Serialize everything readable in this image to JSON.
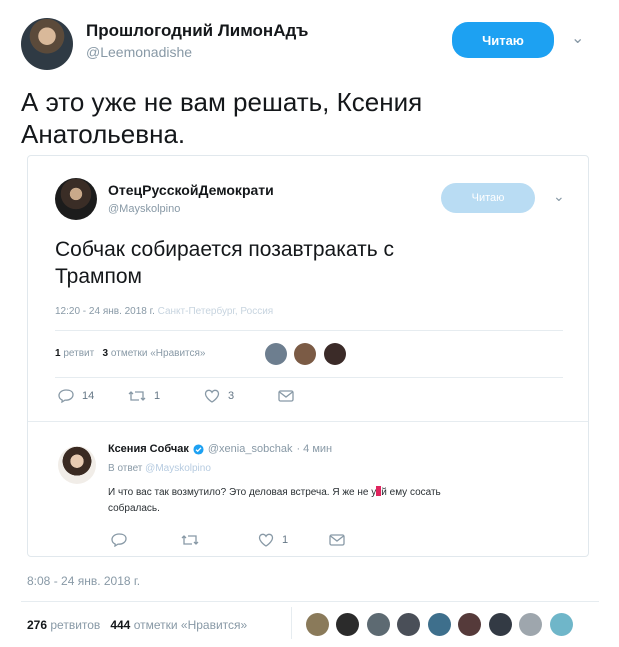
{
  "main_tweet": {
    "author_name": "Прошлогодний ЛимонАдъ",
    "author_handle": "@Leemonadishe",
    "follow_label": "Читаю",
    "text_line1": "А это уже не вам решать, Ксения",
    "text_line2": "Анатольевна.",
    "timestamp": "8:08 - 24 янв. 2018 г.",
    "retweets_count": "276",
    "retweets_label": "ретвитов",
    "likes_count": "444",
    "likes_label": "отметки «Нравится»"
  },
  "quoted_tweet": {
    "author_name": "ОтецРусскойДемократи",
    "author_handle": "@Mayskolpino",
    "follow_label": "Читаю",
    "text_line1": "Собчак собирается позавтракать с",
    "text_line2": "Трампом",
    "timestamp": "12:20 - 24 янв. 2018 г.",
    "location": "Санкт-Петербург, Россия",
    "retweets_count": "1",
    "retweets_label": "ретвит",
    "likes_count": "3",
    "likes_label": "отметки «Нравится»",
    "actions": {
      "reply_count": "14",
      "retweet_count": "1",
      "like_count": "3"
    }
  },
  "reply_tweet": {
    "author_name": "Ксения Собчак",
    "author_handle": "@xenia_sobchak",
    "time": "· 4 мин",
    "reply_to_prefix": "В ответ",
    "reply_to_handle": "@Mayskolpino",
    "text_line1_a": "И что вас так возмутило? Это деловая встреча. Я же не ",
    "text_line1_b": "у",
    "text_line1_c": "й ему сосать",
    "text_line2": "собралась.",
    "actions": {
      "like_count": "1"
    }
  },
  "colors": {
    "follow_button": "#1da1f2",
    "follow_button_faded": "#b9dcf3",
    "verified": "#1da1f2",
    "censor": "#e0245e",
    "muted_text": "#8899a6",
    "border": "#e6ecf0"
  }
}
